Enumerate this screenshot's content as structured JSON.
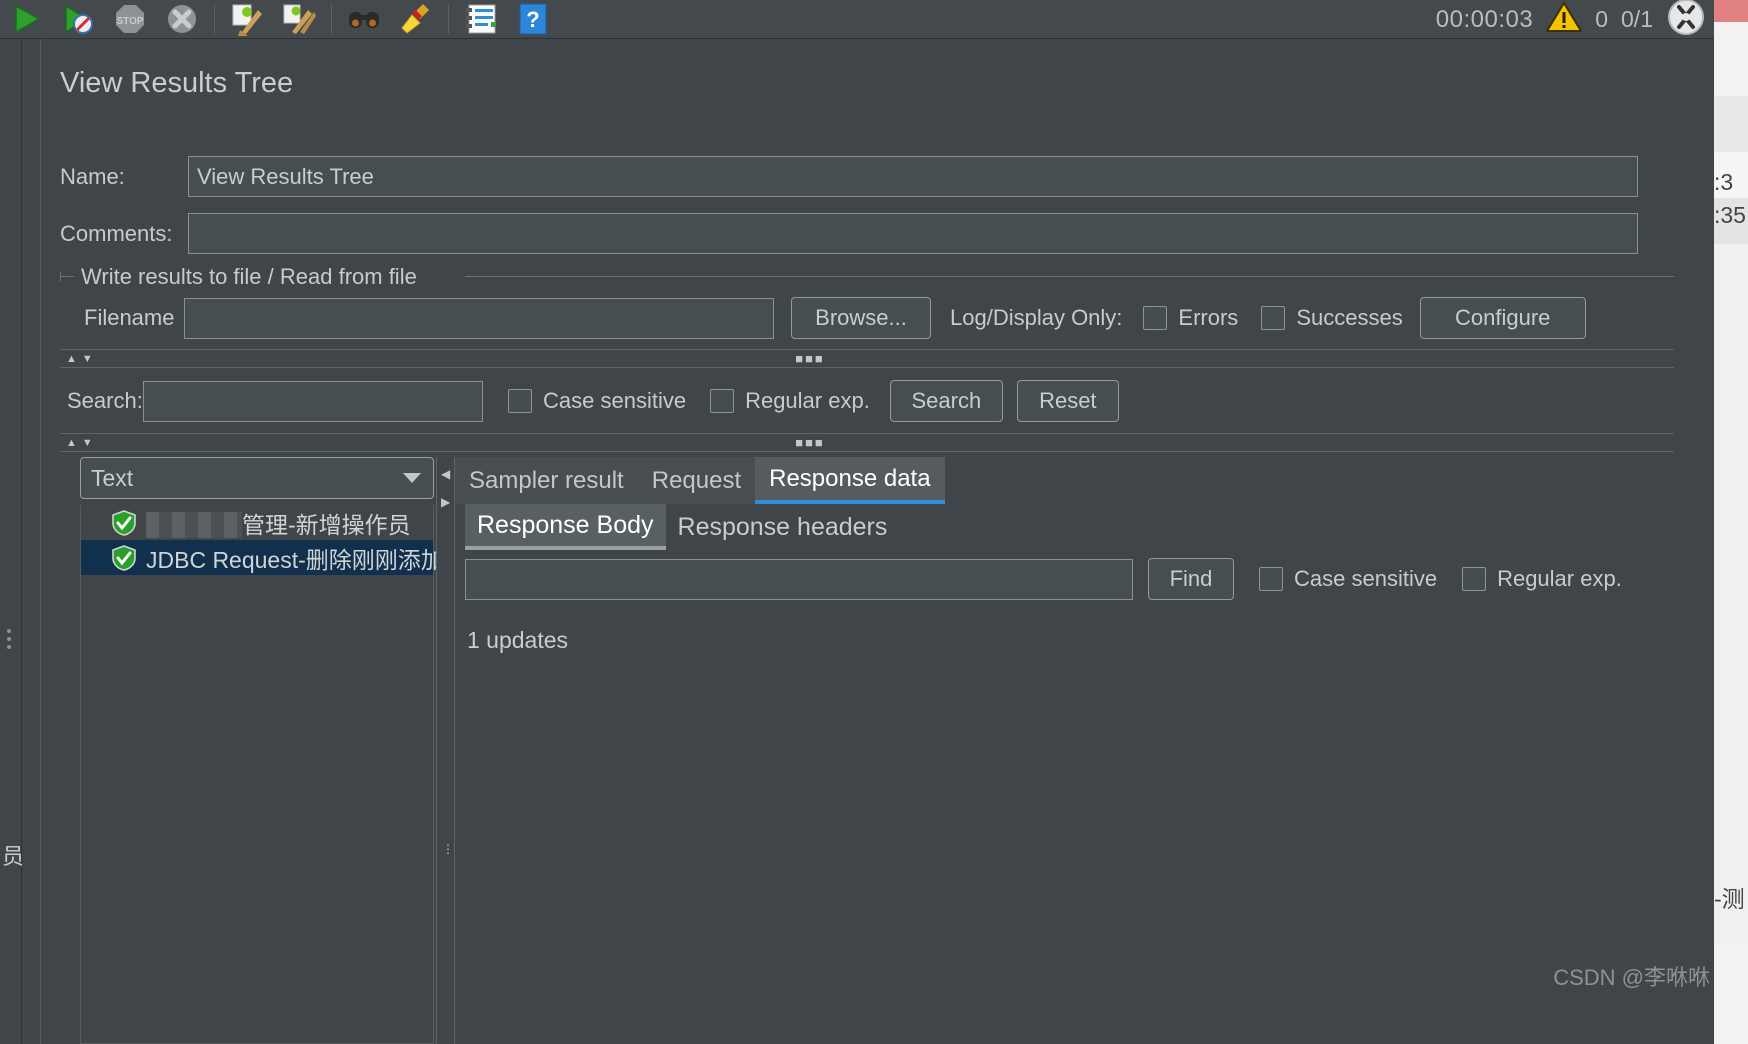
{
  "toolbar": {
    "buttons": [
      {
        "name": "start-button",
        "icon": "play-green-icon"
      },
      {
        "name": "start-no-timers-button",
        "icon": "play-no-timers-icon"
      },
      {
        "name": "stop-button",
        "icon": "stop-icon"
      },
      {
        "name": "shutdown-button",
        "icon": "shutdown-x-icon"
      },
      {
        "name": "clear-button",
        "icon": "broom-clear-icon"
      },
      {
        "name": "clear-all-button",
        "icon": "broom-clear-all-icon"
      },
      {
        "name": "search-button",
        "icon": "binoculars-icon"
      },
      {
        "name": "reset-search-button",
        "icon": "yellow-broom-icon"
      },
      {
        "name": "function-helper-button",
        "icon": "notepad-lines-icon"
      },
      {
        "name": "help-button",
        "icon": "question-mark-icon"
      }
    ],
    "timer": "00:00:03",
    "warning_count": "0",
    "thread_count": "0/1"
  },
  "panel": {
    "title": "View Results Tree",
    "name_label": "Name:",
    "name_value": "View Results Tree",
    "comments_label": "Comments:",
    "comments_value": "",
    "file_group_caption": "Write results to file / Read from file",
    "filename_label": "Filename",
    "filename_value": "",
    "browse_label": "Browse...",
    "log_display_label": "Log/Display Only:",
    "errors_label": "Errors",
    "errors_checked": false,
    "successes_label": "Successes",
    "successes_checked": false,
    "configure_label": "Configure"
  },
  "search_bar": {
    "label": "Search:",
    "value": "",
    "case_sensitive_label": "Case sensitive",
    "case_sensitive_checked": false,
    "regular_exp_label": "Regular exp.",
    "regular_exp_checked": false,
    "search_button": "Search",
    "reset_button": "Reset"
  },
  "tree": {
    "renderer_selected": "Text",
    "items": [
      {
        "name": "tree-item-redacted",
        "label": "管理-新增操作员",
        "status": "success",
        "redacted": true,
        "selected": false
      },
      {
        "name": "tree-item-jdbc-request",
        "label": "JDBC Request-删除刚刚添加",
        "status": "success",
        "redacted": false,
        "selected": true
      }
    ]
  },
  "result_tabs": {
    "items": [
      "Sampler result",
      "Request",
      "Response data"
    ],
    "active": "Response data"
  },
  "response_subtabs": {
    "items": [
      "Response Body",
      "Response headers"
    ],
    "active": "Response Body"
  },
  "find_bar": {
    "value": "",
    "find_button": "Find",
    "case_sensitive_label": "Case sensitive",
    "case_sensitive_checked": false,
    "regular_exp_label": "Regular exp.",
    "regular_exp_checked": false
  },
  "response_body": {
    "text": "1 updates"
  },
  "left_rail": {
    "label": "员"
  },
  "background_window": {
    "time_1": ":3",
    "time_2": ":35",
    "fragment": "-测"
  },
  "watermark": "CSDN @李咻咻",
  "colors": {
    "app_bg": "#3f4548",
    "accent": "#2d8fd5",
    "selection": "#10304d",
    "field_bg": "#474e51",
    "text": "#c9cdcd"
  }
}
